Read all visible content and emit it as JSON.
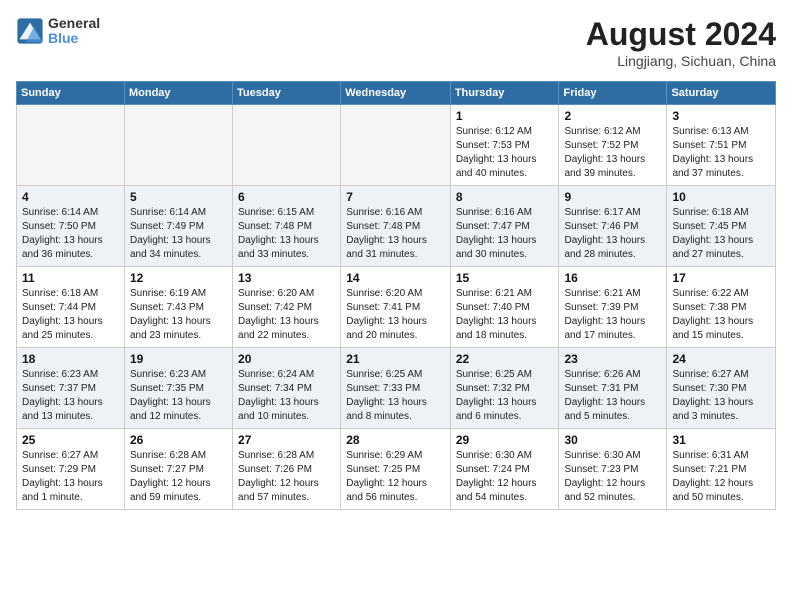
{
  "header": {
    "logo_line1": "General",
    "logo_line2": "Blue",
    "month": "August 2024",
    "location": "Lingjiang, Sichuan, China"
  },
  "days_of_week": [
    "Sunday",
    "Monday",
    "Tuesday",
    "Wednesday",
    "Thursday",
    "Friday",
    "Saturday"
  ],
  "weeks": [
    [
      {
        "day": "",
        "info": ""
      },
      {
        "day": "",
        "info": ""
      },
      {
        "day": "",
        "info": ""
      },
      {
        "day": "",
        "info": ""
      },
      {
        "day": "1",
        "info": "Sunrise: 6:12 AM\nSunset: 7:53 PM\nDaylight: 13 hours\nand 40 minutes."
      },
      {
        "day": "2",
        "info": "Sunrise: 6:12 AM\nSunset: 7:52 PM\nDaylight: 13 hours\nand 39 minutes."
      },
      {
        "day": "3",
        "info": "Sunrise: 6:13 AM\nSunset: 7:51 PM\nDaylight: 13 hours\nand 37 minutes."
      }
    ],
    [
      {
        "day": "4",
        "info": "Sunrise: 6:14 AM\nSunset: 7:50 PM\nDaylight: 13 hours\nand 36 minutes."
      },
      {
        "day": "5",
        "info": "Sunrise: 6:14 AM\nSunset: 7:49 PM\nDaylight: 13 hours\nand 34 minutes."
      },
      {
        "day": "6",
        "info": "Sunrise: 6:15 AM\nSunset: 7:48 PM\nDaylight: 13 hours\nand 33 minutes."
      },
      {
        "day": "7",
        "info": "Sunrise: 6:16 AM\nSunset: 7:48 PM\nDaylight: 13 hours\nand 31 minutes."
      },
      {
        "day": "8",
        "info": "Sunrise: 6:16 AM\nSunset: 7:47 PM\nDaylight: 13 hours\nand 30 minutes."
      },
      {
        "day": "9",
        "info": "Sunrise: 6:17 AM\nSunset: 7:46 PM\nDaylight: 13 hours\nand 28 minutes."
      },
      {
        "day": "10",
        "info": "Sunrise: 6:18 AM\nSunset: 7:45 PM\nDaylight: 13 hours\nand 27 minutes."
      }
    ],
    [
      {
        "day": "11",
        "info": "Sunrise: 6:18 AM\nSunset: 7:44 PM\nDaylight: 13 hours\nand 25 minutes."
      },
      {
        "day": "12",
        "info": "Sunrise: 6:19 AM\nSunset: 7:43 PM\nDaylight: 13 hours\nand 23 minutes."
      },
      {
        "day": "13",
        "info": "Sunrise: 6:20 AM\nSunset: 7:42 PM\nDaylight: 13 hours\nand 22 minutes."
      },
      {
        "day": "14",
        "info": "Sunrise: 6:20 AM\nSunset: 7:41 PM\nDaylight: 13 hours\nand 20 minutes."
      },
      {
        "day": "15",
        "info": "Sunrise: 6:21 AM\nSunset: 7:40 PM\nDaylight: 13 hours\nand 18 minutes."
      },
      {
        "day": "16",
        "info": "Sunrise: 6:21 AM\nSunset: 7:39 PM\nDaylight: 13 hours\nand 17 minutes."
      },
      {
        "day": "17",
        "info": "Sunrise: 6:22 AM\nSunset: 7:38 PM\nDaylight: 13 hours\nand 15 minutes."
      }
    ],
    [
      {
        "day": "18",
        "info": "Sunrise: 6:23 AM\nSunset: 7:37 PM\nDaylight: 13 hours\nand 13 minutes."
      },
      {
        "day": "19",
        "info": "Sunrise: 6:23 AM\nSunset: 7:35 PM\nDaylight: 13 hours\nand 12 minutes."
      },
      {
        "day": "20",
        "info": "Sunrise: 6:24 AM\nSunset: 7:34 PM\nDaylight: 13 hours\nand 10 minutes."
      },
      {
        "day": "21",
        "info": "Sunrise: 6:25 AM\nSunset: 7:33 PM\nDaylight: 13 hours\nand 8 minutes."
      },
      {
        "day": "22",
        "info": "Sunrise: 6:25 AM\nSunset: 7:32 PM\nDaylight: 13 hours\nand 6 minutes."
      },
      {
        "day": "23",
        "info": "Sunrise: 6:26 AM\nSunset: 7:31 PM\nDaylight: 13 hours\nand 5 minutes."
      },
      {
        "day": "24",
        "info": "Sunrise: 6:27 AM\nSunset: 7:30 PM\nDaylight: 13 hours\nand 3 minutes."
      }
    ],
    [
      {
        "day": "25",
        "info": "Sunrise: 6:27 AM\nSunset: 7:29 PM\nDaylight: 13 hours\nand 1 minute."
      },
      {
        "day": "26",
        "info": "Sunrise: 6:28 AM\nSunset: 7:27 PM\nDaylight: 12 hours\nand 59 minutes."
      },
      {
        "day": "27",
        "info": "Sunrise: 6:28 AM\nSunset: 7:26 PM\nDaylight: 12 hours\nand 57 minutes."
      },
      {
        "day": "28",
        "info": "Sunrise: 6:29 AM\nSunset: 7:25 PM\nDaylight: 12 hours\nand 56 minutes."
      },
      {
        "day": "29",
        "info": "Sunrise: 6:30 AM\nSunset: 7:24 PM\nDaylight: 12 hours\nand 54 minutes."
      },
      {
        "day": "30",
        "info": "Sunrise: 6:30 AM\nSunset: 7:23 PM\nDaylight: 12 hours\nand 52 minutes."
      },
      {
        "day": "31",
        "info": "Sunrise: 6:31 AM\nSunset: 7:21 PM\nDaylight: 12 hours\nand 50 minutes."
      }
    ]
  ]
}
